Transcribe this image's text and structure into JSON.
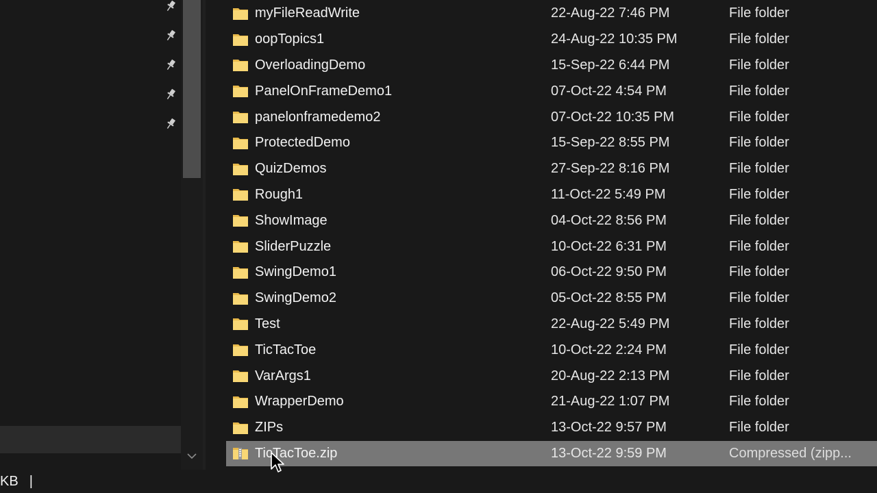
{
  "nav": {
    "pinned_icons": [
      "pin-icon",
      "pin-icon",
      "pin-icon",
      "pin-icon",
      "pin-icon"
    ]
  },
  "files": [
    {
      "name": "myFileReadWrite",
      "date": "22-Aug-22 7:46 PM",
      "type": "File folder",
      "icon": "folder-icon"
    },
    {
      "name": "oopTopics1",
      "date": "24-Aug-22 10:35 PM",
      "type": "File folder",
      "icon": "folder-icon"
    },
    {
      "name": "OverloadingDemo",
      "date": "15-Sep-22 6:44 PM",
      "type": "File folder",
      "icon": "folder-icon"
    },
    {
      "name": "PanelOnFrameDemo1",
      "date": "07-Oct-22 4:54 PM",
      "type": "File folder",
      "icon": "folder-icon"
    },
    {
      "name": "panelonframedemo2",
      "date": "07-Oct-22 10:35 PM",
      "type": "File folder",
      "icon": "folder-icon"
    },
    {
      "name": "ProtectedDemo",
      "date": "15-Sep-22 8:55 PM",
      "type": "File folder",
      "icon": "folder-icon"
    },
    {
      "name": "QuizDemos",
      "date": "27-Sep-22 8:16 PM",
      "type": "File folder",
      "icon": "folder-icon"
    },
    {
      "name": "Rough1",
      "date": "11-Oct-22 5:49 PM",
      "type": "File folder",
      "icon": "folder-icon"
    },
    {
      "name": "ShowImage",
      "date": "04-Oct-22 8:56 PM",
      "type": "File folder",
      "icon": "folder-icon"
    },
    {
      "name": "SliderPuzzle",
      "date": "10-Oct-22 6:31 PM",
      "type": "File folder",
      "icon": "folder-icon"
    },
    {
      "name": "SwingDemo1",
      "date": "06-Oct-22 9:50 PM",
      "type": "File folder",
      "icon": "folder-icon"
    },
    {
      "name": "SwingDemo2",
      "date": "05-Oct-22 8:55 PM",
      "type": "File folder",
      "icon": "folder-icon"
    },
    {
      "name": "Test",
      "date": "22-Aug-22 5:49 PM",
      "type": "File folder",
      "icon": "folder-icon"
    },
    {
      "name": "TicTacToe",
      "date": "10-Oct-22 2:24 PM",
      "type": "File folder",
      "icon": "folder-icon"
    },
    {
      "name": "VarArgs1",
      "date": "20-Aug-22 2:13 PM",
      "type": "File folder",
      "icon": "folder-icon"
    },
    {
      "name": "WrapperDemo",
      "date": "21-Aug-22 1:07 PM",
      "type": "File folder",
      "icon": "folder-icon"
    },
    {
      "name": "ZIPs",
      "date": "13-Oct-22 9:57 PM",
      "type": "File folder",
      "icon": "folder-icon"
    },
    {
      "name": "TicTacToe.zip",
      "date": "13-Oct-22 9:59 PM",
      "type": "Compressed (zipp...",
      "icon": "zip-folder-icon",
      "selected": true
    }
  ],
  "status": {
    "size_text": "KB",
    "separator": "|"
  },
  "colors": {
    "background": "#191919",
    "selected_row": "#777777",
    "folder_yellow": "#f8d775",
    "folder_shade": "#e8b94a"
  }
}
